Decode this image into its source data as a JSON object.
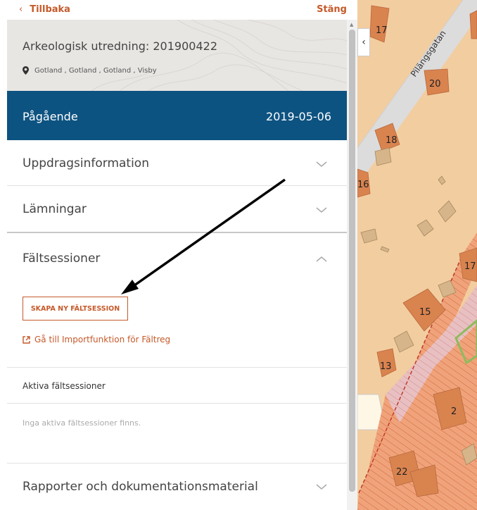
{
  "nav": {
    "back_label": "Tillbaka",
    "close_label": "Stäng"
  },
  "header": {
    "title": "Arkeologisk utredning: 201900422",
    "location": "Gotland , Gotland , Gotland , Visby"
  },
  "status": {
    "label": "Pågående",
    "date": "2019-05-06"
  },
  "sections": {
    "uppdrag": "Uppdragsinformation",
    "lamningar": "Lämningar",
    "faltsessioner": "Fältsessioner",
    "rapporter": "Rapporter och dokumentationsmaterial"
  },
  "faltsessioner": {
    "create_button": "SKAPA NY FÄLTSESSION",
    "import_link": "Gå till Importfunktion för Fältreg",
    "active_heading": "Aktiva fältsessioner",
    "empty_text": "Inga aktiva fältsessioner finns."
  },
  "map": {
    "street": "Pilängsgatan",
    "plot_numbers": [
      "17",
      "20",
      "18",
      "16",
      "17",
      "15",
      "13",
      "2",
      "22"
    ],
    "colors": {
      "land": "#f2cda0",
      "building": "#d9834f",
      "outbuilding": "#d7b58a",
      "road": "#dcdcdc",
      "hatched": "#f0a37a"
    }
  },
  "colors": {
    "accent": "#c55a2a",
    "status_bar": "#0d5381",
    "header_bg": "#e8e6e3"
  },
  "icons": {
    "back": "chevron-left-icon",
    "location": "map-pin-icon",
    "external": "external-link-icon",
    "expand": "chevron-down-icon",
    "collapse": "chevron-up-icon"
  }
}
